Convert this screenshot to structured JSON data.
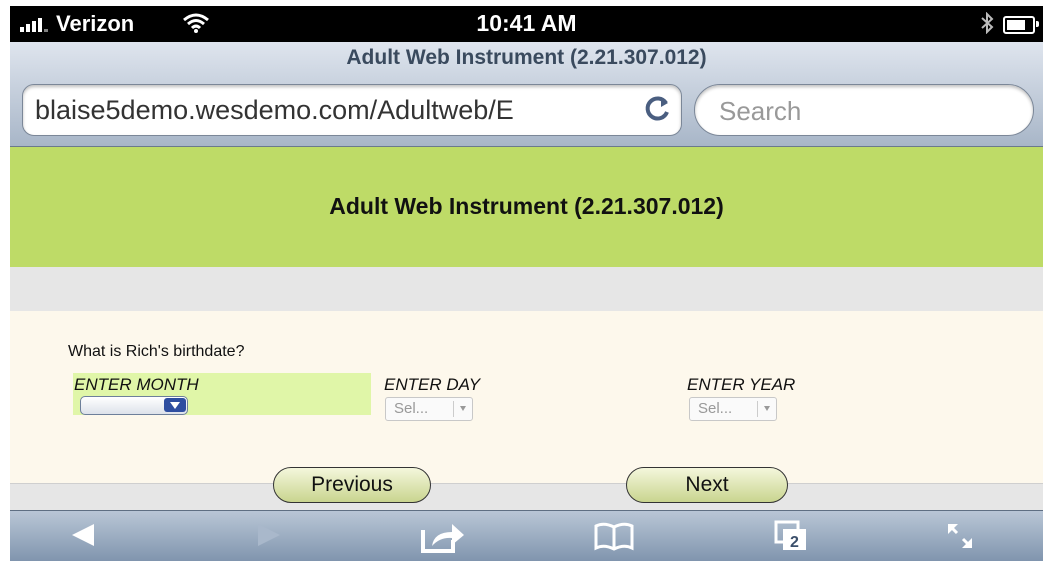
{
  "status_bar": {
    "carrier": "Verizon",
    "time": "10:41 AM"
  },
  "browser": {
    "page_title": "Adult Web Instrument (2.21.307.012)",
    "url": "blaise5demo.wesdemo.com/Adultweb/E",
    "search_placeholder": "Search",
    "tabs_count": "2"
  },
  "page": {
    "header_title": "Adult Web Instrument (2.21.307.012)",
    "question": "What is Rich's birthdate?",
    "fields": {
      "month_label": "ENTER MONTH",
      "day_label": "ENTER DAY",
      "day_value": "Sel...",
      "year_label": "ENTER YEAR",
      "year_value": "Sel..."
    },
    "buttons": {
      "previous": "Previous",
      "next": "Next"
    }
  },
  "colors": {
    "header_green": "#bedb67",
    "month_highlight": "#e0f6a8",
    "page_background": "#fdf8ec"
  },
  "icons": [
    "signal-bars",
    "wifi-icon",
    "bluetooth-icon",
    "battery-icon",
    "reload-icon",
    "back-icon",
    "forward-icon",
    "share-icon",
    "bookmarks-icon",
    "tabs-icon",
    "fullscreen-icon"
  ]
}
